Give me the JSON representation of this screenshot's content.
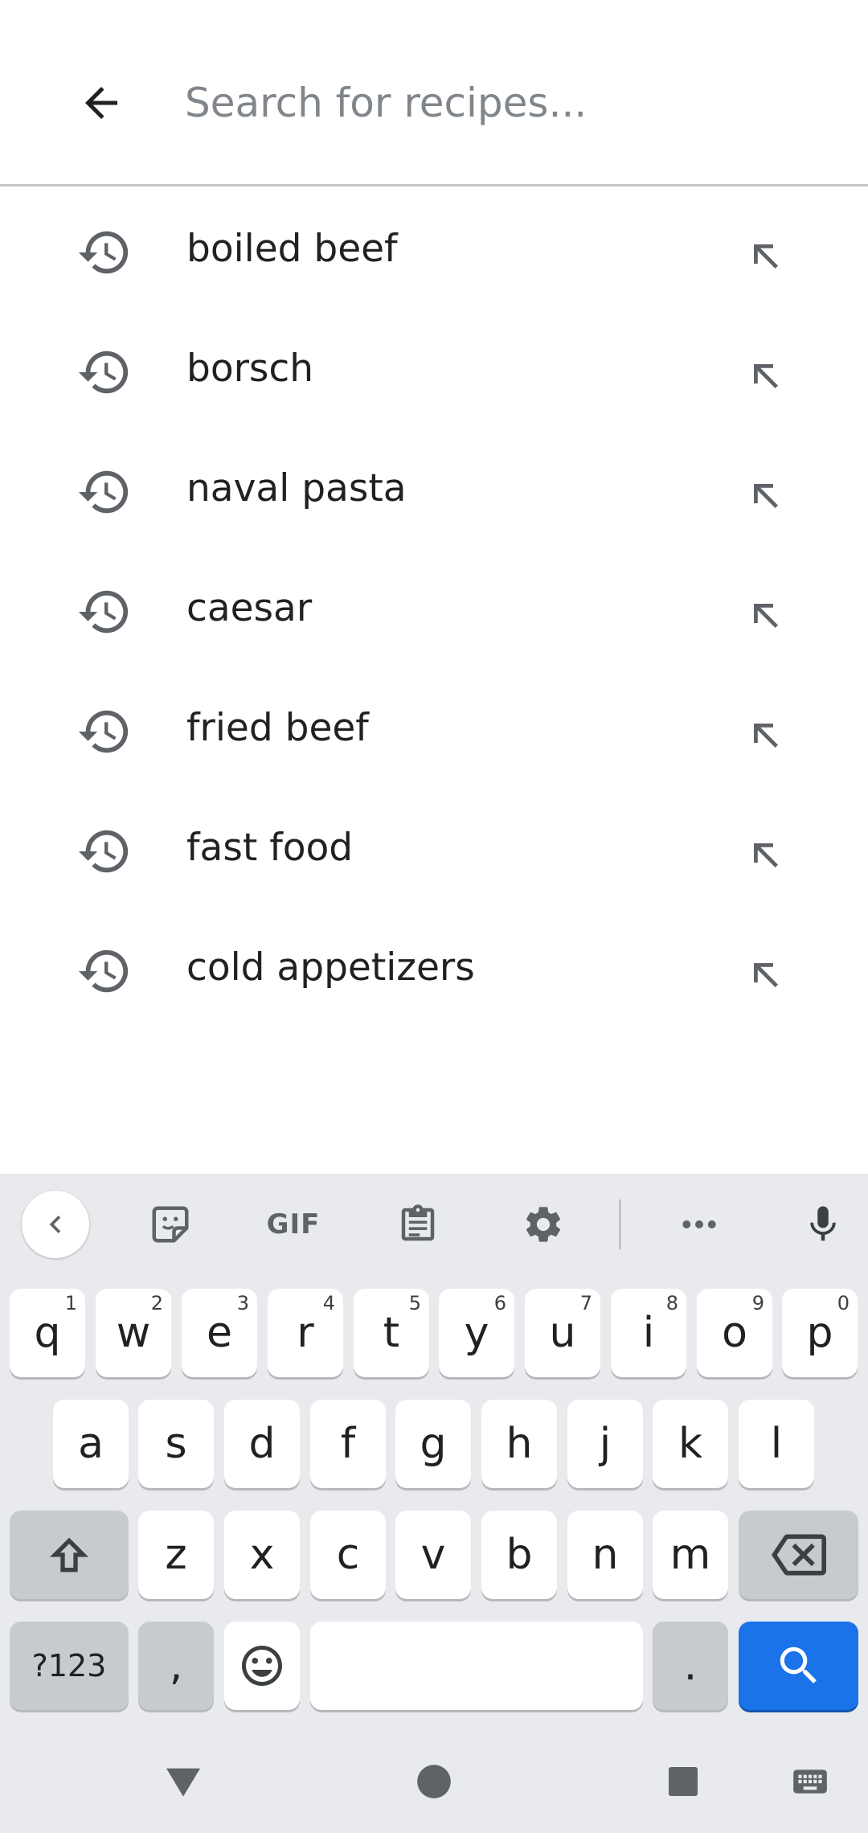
{
  "search": {
    "placeholder": "Search for recipes...",
    "value": ""
  },
  "history": [
    {
      "text": "boiled beef"
    },
    {
      "text": "borsch"
    },
    {
      "text": "naval pasta"
    },
    {
      "text": "caesar"
    },
    {
      "text": "fried beef"
    },
    {
      "text": "fast food"
    },
    {
      "text": "cold appetizers"
    }
  ],
  "keyboard": {
    "toolbar": {
      "gif_label": "GIF"
    },
    "row1": [
      {
        "key": "q",
        "hint": "1"
      },
      {
        "key": "w",
        "hint": "2"
      },
      {
        "key": "e",
        "hint": "3"
      },
      {
        "key": "r",
        "hint": "4"
      },
      {
        "key": "t",
        "hint": "5"
      },
      {
        "key": "y",
        "hint": "6"
      },
      {
        "key": "u",
        "hint": "7"
      },
      {
        "key": "i",
        "hint": "8"
      },
      {
        "key": "o",
        "hint": "9"
      },
      {
        "key": "p",
        "hint": "0"
      }
    ],
    "row2": [
      "a",
      "s",
      "d",
      "f",
      "g",
      "h",
      "j",
      "k",
      "l"
    ],
    "row3": [
      "z",
      "x",
      "c",
      "v",
      "b",
      "n",
      "m"
    ],
    "row4": {
      "symbols_label": "?123",
      "comma_label": ",",
      "period_label": "."
    }
  },
  "colors": {
    "accent": "#1a73e8",
    "keyboard_bg": "#e8eaed",
    "key_bg": "#ffffff",
    "key_dark_bg": "#c7cacf",
    "icon_gray": "#5f6368",
    "placeholder_gray": "#80868b"
  }
}
